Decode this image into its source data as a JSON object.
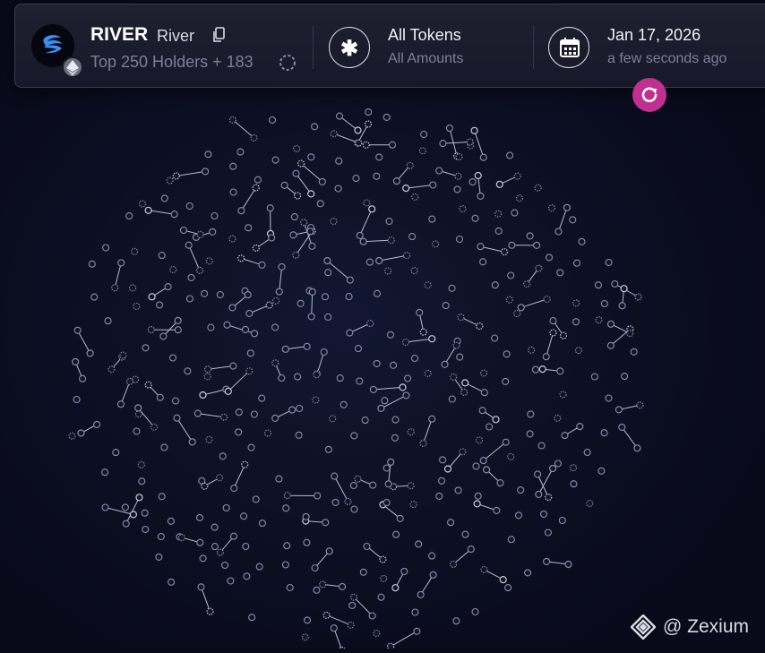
{
  "token": {
    "symbol": "RIVER",
    "name": "River",
    "holders_label": "Top 250 Holders + 183",
    "chain_icon": "ethereum-icon",
    "logo_color": "#3b8ff0"
  },
  "filter": {
    "title": "All Tokens",
    "subtitle": "All Amounts",
    "icon": "asterisk-icon"
  },
  "date": {
    "title": "Jan 17, 2026",
    "subtitle": "a few seconds ago",
    "icon": "calendar-icon"
  },
  "refresh": {
    "icon": "refresh-icon",
    "color": "#c0308e"
  },
  "brand": {
    "text": "@ Zexium",
    "icon": "zexium-logo-icon"
  },
  "graph": {
    "node_count": 433,
    "node_color": "#8a8ca8",
    "edge_color": "#b8bad0"
  }
}
